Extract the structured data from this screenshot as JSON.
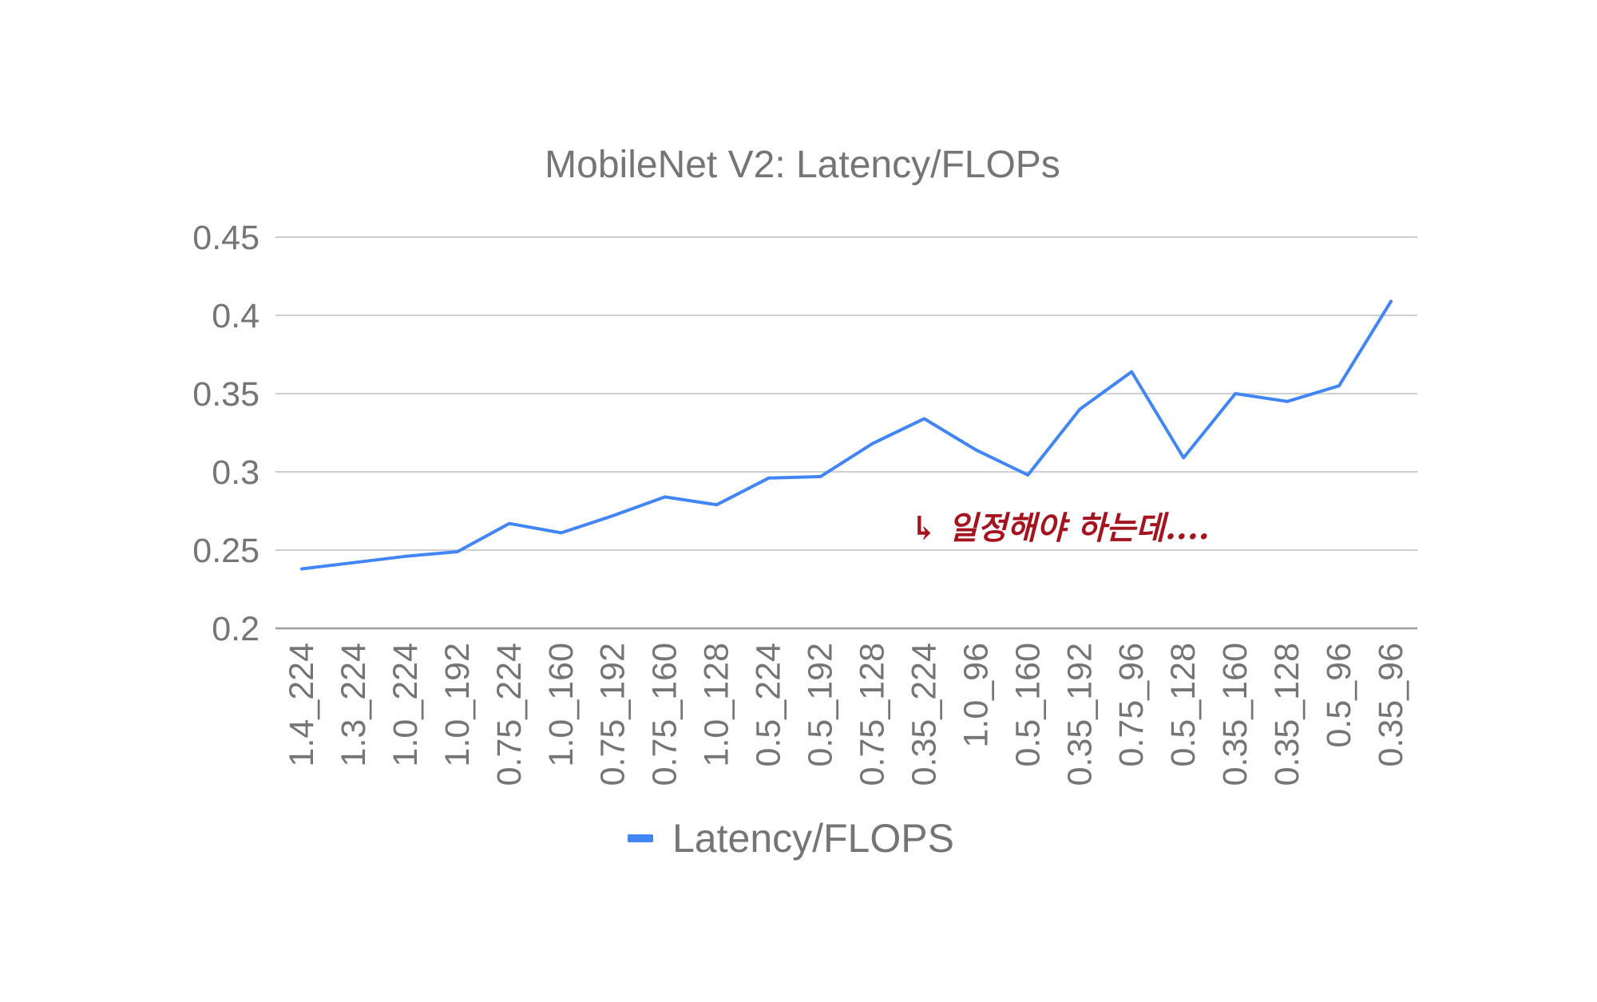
{
  "chart_data": {
    "type": "line",
    "title": "MobileNet V2: Latency/FLOPs",
    "xlabel": "",
    "ylabel": "",
    "categories": [
      "1.4_224",
      "1.3_224",
      "1.0_224",
      "1.0_192",
      "0.75_224",
      "1.0_160",
      "0.75_192",
      "0.75_160",
      "1.0_128",
      "0.5_224",
      "0.5_192",
      "0.75_128",
      "0.35_224",
      "1.0_96",
      "0.5_160",
      "0.35_192",
      "0.75_96",
      "0.5_128",
      "0.35_160",
      "0.35_128",
      "0.5_96",
      "0.35_96"
    ],
    "series": [
      {
        "name": "Latency/FLOPS",
        "color": "#4285f4",
        "values": [
          0.238,
          0.242,
          0.246,
          0.249,
          0.267,
          0.261,
          0.272,
          0.284,
          0.279,
          0.296,
          0.297,
          0.318,
          0.334,
          0.314,
          0.298,
          0.34,
          0.364,
          0.309,
          0.35,
          0.345,
          0.355,
          0.409
        ]
      }
    ],
    "ylim": [
      0.2,
      0.45
    ],
    "yticks": [
      "0.2",
      "0.25",
      "0.3",
      "0.35",
      "0.4",
      "0.45"
    ],
    "grid": true,
    "legend_position": "bottom",
    "annotation": {
      "text": "↳ 일정해야 하는데....",
      "color": "#a3141e"
    }
  }
}
